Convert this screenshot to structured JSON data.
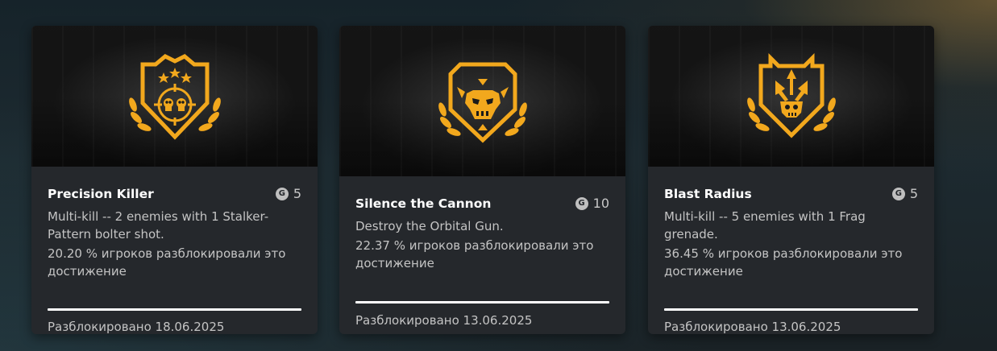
{
  "cards": [
    {
      "title": "Precision Killer",
      "gamerscore": "5",
      "gamerscore_icon": "G",
      "description": "Multi-kill -- 2 enemies with 1 Stalker-Pattern bolter shot.",
      "percent": "20.20 % игроков разблокировали это достижение",
      "unlocked": "Разблокировано 18.06.2025",
      "emblem_icon": "crosshair-skulls-stars-icon"
    },
    {
      "title": "Silence the Cannon",
      "gamerscore": "10",
      "gamerscore_icon": "G",
      "description": "Destroy the Orbital Gun.",
      "percent": "22.37 % игроков разблокировали это достижение",
      "unlocked": "Разблокировано 13.06.2025",
      "emblem_icon": "ork-skull-icon"
    },
    {
      "title": "Blast Radius",
      "gamerscore": "5",
      "gamerscore_icon": "G",
      "description": "Multi-kill -- 5 enemies with 1 Frag grenade.",
      "percent": "36.45 % игроков разблокировали это достижение",
      "unlocked": "Разблокировано 13.06.2025",
      "emblem_icon": "explosion-skull-icon"
    }
  ],
  "colors": {
    "emblem": "#f2a81d",
    "card_bg": "#25282c",
    "text": "#c4c4c4"
  }
}
